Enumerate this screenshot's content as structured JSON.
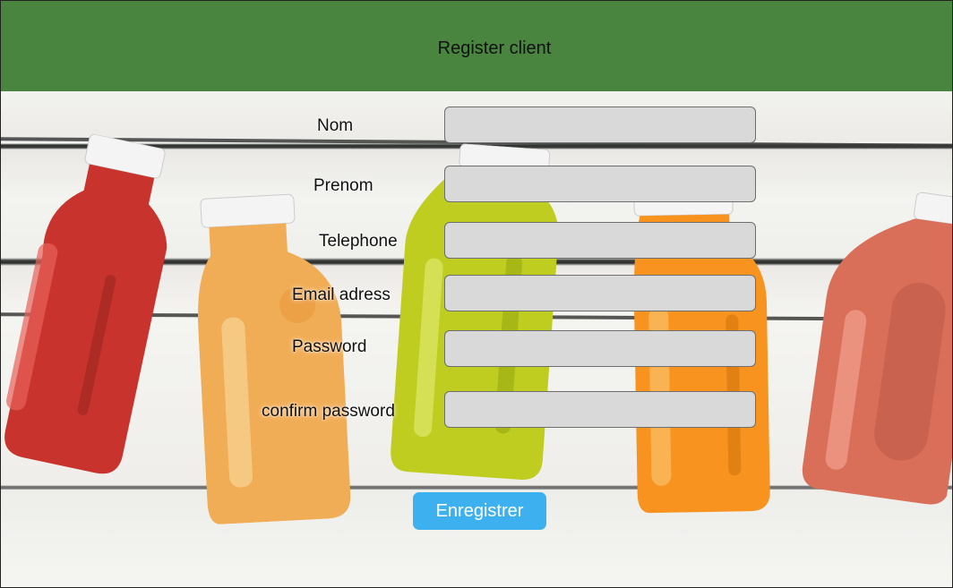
{
  "header": {
    "title": "Register client"
  },
  "form": {
    "fields": [
      {
        "label": "Nom",
        "value": "",
        "placeholder": ""
      },
      {
        "label": "Prenom",
        "value": "",
        "placeholder": ""
      },
      {
        "label": "Telephone",
        "value": "",
        "placeholder": ""
      },
      {
        "label": "Email adress",
        "value": "",
        "placeholder": ""
      },
      {
        "label": "Password",
        "value": "",
        "placeholder": ""
      },
      {
        "label": "confirm password",
        "value": "",
        "placeholder": ""
      }
    ],
    "submit_label": "Enregistrer"
  },
  "colors": {
    "header_bg": "#4a8540",
    "button_bg": "#3db1ef",
    "input_bg": "#d9d9d9"
  }
}
